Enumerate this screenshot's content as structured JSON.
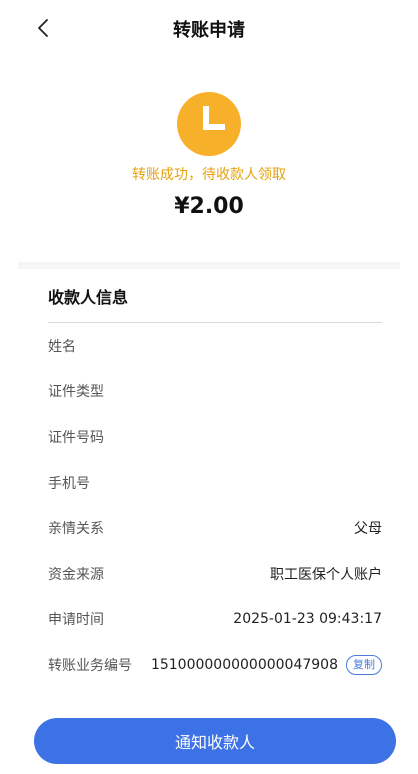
{
  "header": {
    "title": "转账申请",
    "back_icon": "chevron-left-icon"
  },
  "status": {
    "icon": "clock-icon",
    "icon_color": "#f7b02a",
    "message": "转账成功，待收款人领取",
    "message_color": "#e5a20f",
    "amount": "¥2.00"
  },
  "payee": {
    "section_title": "收款人信息",
    "rows": [
      {
        "label": "姓名",
        "value": ""
      },
      {
        "label": "证件类型",
        "value": ""
      },
      {
        "label": "证件号码",
        "value": ""
      },
      {
        "label": "手机号",
        "value": ""
      },
      {
        "label": "亲情关系",
        "value": "父母"
      },
      {
        "label": "资金来源",
        "value": "职工医保个人账户"
      },
      {
        "label": "申请时间",
        "value": "2025-01-23 09:43:17"
      },
      {
        "label": "转账业务编号",
        "value": "151000000000000047908",
        "action": "复制"
      }
    ]
  },
  "footer": {
    "notify_label": "通知收款人",
    "accent": "#3d72e6"
  }
}
